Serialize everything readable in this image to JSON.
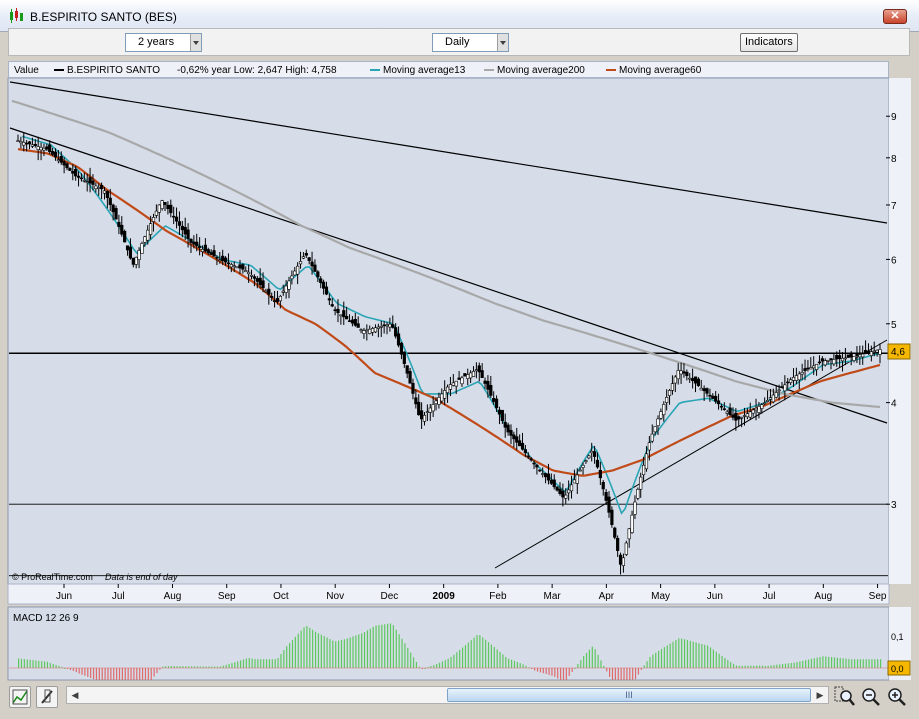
{
  "window": {
    "title": "B.ESPIRITO SANTO (BES)",
    "close_label": "✕"
  },
  "toolbar": {
    "period": "2 years",
    "interval": "Daily",
    "indicators_label": "Indicators"
  },
  "legend": {
    "value_label": "Value",
    "instrument": "B.ESPIRITO SANTO",
    "stats": "-0,62% year Low: 2,647 High: 4,758",
    "ma13": "Moving average13",
    "ma200": "Moving average200",
    "ma60": "Moving average60"
  },
  "colors": {
    "ma13": "#2aa5b5",
    "ma200": "#a8a8a8",
    "ma60": "#c04a18",
    "price": "#000000",
    "macd_pos": "#5ec85e",
    "macd_neg": "#e06a6a",
    "last_price_bg": "#f5b700",
    "panel_bg": "#d6dde9"
  },
  "price_axis": {
    "ticks": [
      "9",
      "8",
      "7",
      "6",
      "5",
      "4",
      "3"
    ],
    "last_price": "4,6"
  },
  "time_axis": {
    "labels": [
      "Jun",
      "Jul",
      "Aug",
      "Sep",
      "Oct",
      "Nov",
      "Dec",
      "2009",
      "Feb",
      "Mar",
      "Apr",
      "May",
      "Jun",
      "Jul",
      "Aug",
      "Sep"
    ]
  },
  "footer": {
    "source": "© ProRealTime.com",
    "note": "Data is end of day"
  },
  "macd": {
    "label": "MACD 12 26 9",
    "ticks": [
      "0,1",
      "0,0"
    ]
  },
  "icons": {
    "app": "candlestick-icon",
    "chart_tool": "chart-tool-icon",
    "draw_tool": "draw-tool-icon",
    "zoom_select": "zoom-select-icon",
    "zoom_out": "zoom-out-icon",
    "zoom_in": "zoom-in-icon"
  },
  "scrollbar": {
    "grip": "III"
  },
  "chart_data": {
    "type": "candlestick",
    "ylim": [
      2.4,
      10
    ],
    "y_scale": "log",
    "series": [
      {
        "name": "B.ESPIRITO SANTO",
        "values": [
          8.4,
          8.2,
          7.6,
          7.3,
          5.9,
          7.1,
          6.3,
          6.0,
          5.8,
          5.3,
          6.1,
          5.2,
          4.9,
          5.0,
          3.8,
          4.2,
          4.4,
          3.7,
          3.35,
          3.05,
          3.5,
          2.5,
          3.6,
          4.4,
          4.1,
          3.8,
          4.0,
          4.3,
          4.5,
          4.55,
          4.65
        ]
      },
      {
        "name": "Moving average13",
        "values": [
          8.5,
          8.3,
          7.7,
          6.9,
          6.1,
          6.6,
          6.3,
          6.0,
          5.9,
          5.5,
          5.9,
          5.3,
          5.1,
          5.0,
          4.1,
          4.1,
          4.25,
          3.7,
          3.35,
          3.1,
          3.55,
          2.9,
          3.6,
          4.0,
          4.05,
          3.9,
          4.0,
          4.2,
          4.45,
          4.5,
          4.6
        ]
      },
      {
        "name": "Moving average60",
        "values": [
          8.2,
          8.1,
          7.8,
          7.3,
          6.9,
          6.5,
          6.2,
          5.9,
          5.6,
          5.2,
          5.0,
          4.7,
          4.35,
          4.2,
          4.05,
          3.85,
          3.65,
          3.45,
          3.3,
          3.25,
          3.3,
          3.4,
          3.55,
          3.7,
          3.85,
          3.95,
          4.1,
          4.25,
          4.35,
          4.45
        ]
      },
      {
        "name": "Moving average200",
        "values": [
          9.4,
          9.0,
          8.6,
          8.1,
          7.6,
          7.1,
          6.6,
          6.2,
          5.9,
          5.6,
          5.3,
          5.05,
          4.85,
          4.65,
          4.45,
          4.25,
          4.1,
          4.0,
          3.95
        ]
      }
    ],
    "x_labels": [
      "Jun",
      "Jul",
      "Aug",
      "Sep",
      "Oct",
      "Nov",
      "Dec",
      "2009",
      "Feb",
      "Mar",
      "Apr",
      "May",
      "Jun",
      "Jul",
      "Aug",
      "Sep"
    ],
    "horizontal_lines": [
      4.6,
      3.0,
      2.45
    ],
    "grid": false,
    "legend": "top"
  }
}
